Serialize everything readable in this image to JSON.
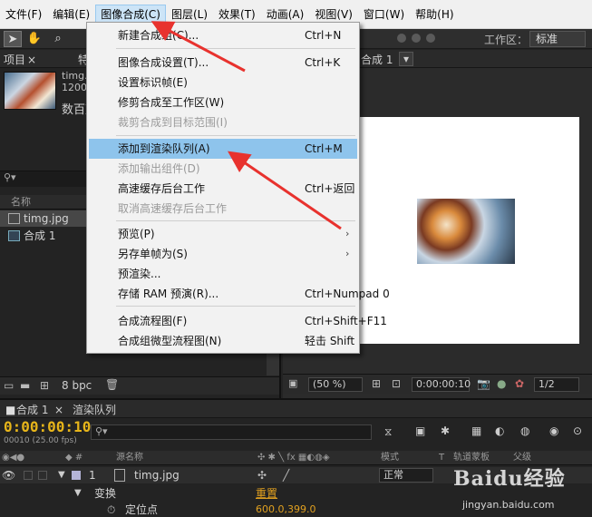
{
  "menubar": {
    "items": [
      "文件(F)",
      "编辑(E)",
      "图像合成(C)",
      "图层(L)",
      "效果(T)",
      "动画(A)",
      "视图(V)",
      "窗口(W)",
      "帮助(H)"
    ],
    "active_index": 2
  },
  "toolbar": {
    "workspace_label": "工作区：",
    "workspace_value": "标准"
  },
  "project_panel": {
    "tab_label": "项目",
    "tab_close": "×",
    "tab_extra": "特",
    "asset_name": "timg.jp",
    "asset_dims": "1200",
    "asset_extra": "数百万",
    "search_placeholder": "",
    "column_name": "名称",
    "items": [
      {
        "name": "timg.jpg",
        "selected": true
      },
      {
        "name": "合成  1",
        "selected": false
      }
    ],
    "bit_depth": "8 bpc"
  },
  "viewer": {
    "tab_label": "合成  1",
    "zoom": "(50 %)",
    "timecode": "0:00:00:10",
    "resolution": "1/2"
  },
  "dropdown": {
    "items": [
      {
        "label": "新建合成组(C)...",
        "shortcut": "Ctrl+N",
        "disabled": false,
        "highlighted": false,
        "submenu": false
      },
      {
        "label": "图像合成设置(T)...",
        "shortcut": "Ctrl+K",
        "disabled": false,
        "highlighted": false,
        "submenu": false
      },
      {
        "label": "设置标识帧(E)",
        "shortcut": "",
        "disabled": false,
        "highlighted": false,
        "submenu": false
      },
      {
        "label": "修剪合成至工作区(W)",
        "shortcut": "",
        "disabled": false,
        "highlighted": false,
        "submenu": false
      },
      {
        "label": "裁剪合成到目标范围(I)",
        "shortcut": "",
        "disabled": true,
        "highlighted": false,
        "submenu": false
      },
      {
        "label": "添加到渲染队列(A)",
        "shortcut": "Ctrl+M",
        "disabled": false,
        "highlighted": true,
        "submenu": false
      },
      {
        "label": "添加输出组件(D)",
        "shortcut": "",
        "disabled": true,
        "highlighted": false,
        "submenu": false
      },
      {
        "label": "高速缓存后台工作",
        "shortcut": "Ctrl+返回",
        "disabled": false,
        "highlighted": false,
        "submenu": false
      },
      {
        "label": "取消高速缓存后台工作",
        "shortcut": "",
        "disabled": true,
        "highlighted": false,
        "submenu": false
      },
      {
        "label": "预览(P)",
        "shortcut": "",
        "disabled": false,
        "highlighted": false,
        "submenu": true
      },
      {
        "label": "另存单帧为(S)",
        "shortcut": "",
        "disabled": false,
        "highlighted": false,
        "submenu": true
      },
      {
        "label": "预渲染...",
        "shortcut": "",
        "disabled": false,
        "highlighted": false,
        "submenu": false
      },
      {
        "label": "存储 RAM 预演(R)...",
        "shortcut": "Ctrl+Numpad 0",
        "disabled": false,
        "highlighted": false,
        "submenu": false
      },
      {
        "label": "合成流程图(F)",
        "shortcut": "Ctrl+Shift+F11",
        "disabled": false,
        "highlighted": false,
        "submenu": false
      },
      {
        "label": "合成组微型流程图(N)",
        "shortcut": "轻击 Shift",
        "disabled": false,
        "highlighted": false,
        "submenu": false
      }
    ]
  },
  "timeline": {
    "tab_comp": "合成  1",
    "tab_close": "×",
    "tab_render": "渲染队列",
    "timecode": "0:00:00:10",
    "frame_info": "00010 (25.00 fps)",
    "col_source": "源名称",
    "col_mode": "模式",
    "col_t": "T",
    "col_track": "轨道蒙板",
    "col_parent": "父级",
    "layer_index": "1",
    "layer_name": "timg.jpg",
    "layer_mode": "正常",
    "transform_label": "变换",
    "reset_label": "重置",
    "anchor_label": "定位点",
    "anchor_value": "600.0,399.0"
  },
  "watermark": {
    "logo": "Baidu经验",
    "url": "jingyan.baidu.com"
  },
  "colors": {
    "menu_highlight": "#8ec4ec",
    "annotation_arrow": "#e8322e",
    "timecode": "#e7b51a"
  }
}
